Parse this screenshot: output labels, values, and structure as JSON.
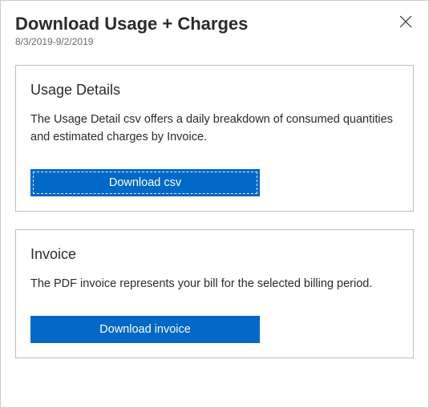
{
  "header": {
    "title": "Download Usage + Charges",
    "date_range": "8/3/2019-9/2/2019"
  },
  "cards": {
    "usage": {
      "title": "Usage Details",
      "description": "The Usage Detail csv offers a daily breakdown of consumed quantities and estimated charges by Invoice.",
      "button_label": "Download csv"
    },
    "invoice": {
      "title": "Invoice",
      "description": "The PDF invoice represents your bill for the selected billing period.",
      "button_label": "Download invoice"
    }
  }
}
